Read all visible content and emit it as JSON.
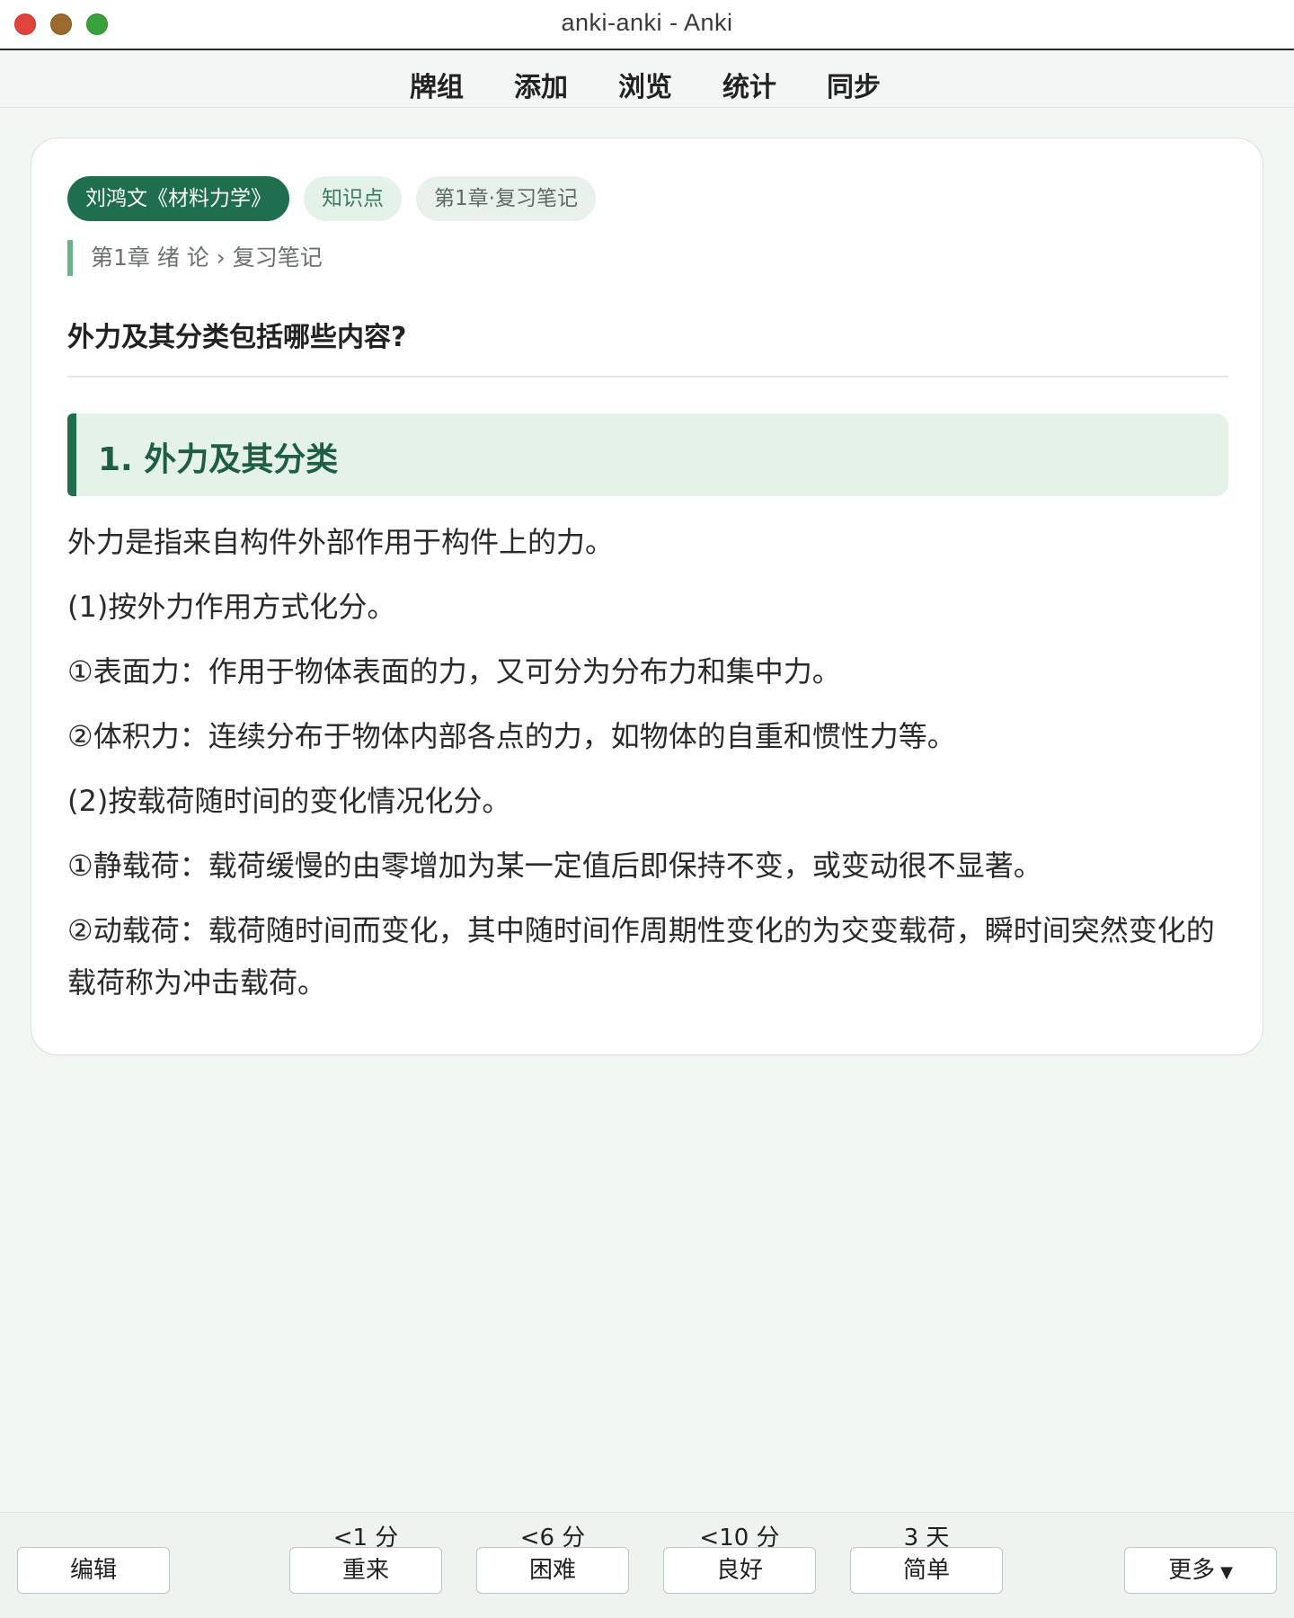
{
  "window": {
    "title": "anki-anki - Anki"
  },
  "toolbar": {
    "items": [
      "牌组",
      "添加",
      "浏览",
      "统计",
      "同步"
    ]
  },
  "card": {
    "tags": [
      "刘鸿文《材料力学》",
      "知识点",
      "第1章·复习笔记"
    ],
    "breadcrumb": "第1章 绪 论 › 复习笔记",
    "question": "外力及其分类包括哪些内容?",
    "section_heading": "1. 外力及其分类",
    "paragraphs": [
      "外力是指来自构件外部作用于构件上的力。",
      "(1)按外力作用方式化分。",
      "①表面力：作用于物体表面的力，又可分为分布力和集中力。",
      "②体积力：连续分布于物体内部各点的力，如物体的自重和惯性力等。",
      "(2)按载荷随时间的变化情况化分。",
      "①静载荷：载荷缓慢的由零增加为某一定值后即保持不变，或变动很不显著。",
      "②动载荷：载荷随时间而变化，其中随时间作周期性变化的为交变载荷，瞬时间突然变化的载荷称为冲击载荷。"
    ]
  },
  "review_bar": {
    "edit_label": "编辑",
    "more_label": "更多",
    "answers": [
      {
        "label": "重来",
        "interval": "<1 分"
      },
      {
        "label": "困难",
        "interval": "<6 分"
      },
      {
        "label": "良好",
        "interval": "<10 分"
      },
      {
        "label": "简单",
        "interval": "3 天"
      }
    ]
  },
  "colors": {
    "accent": "#1f6e4d",
    "tag_bg": "#e5f2ea",
    "section_bg": "#e4f2e9",
    "breadcrumb_bar": "#6bb38b",
    "page_bg": "#f3f7f4"
  }
}
